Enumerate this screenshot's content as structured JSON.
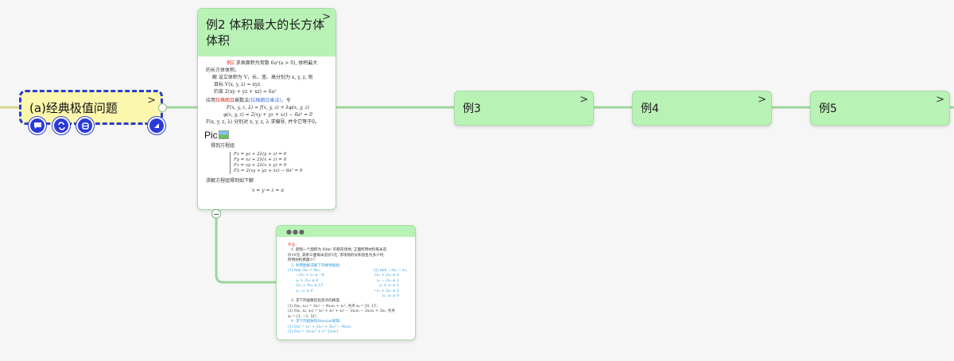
{
  "root": {
    "title": "(a)经典极值问题",
    "icons": [
      "comment-icon",
      "link-icon",
      "tag-icon"
    ]
  },
  "nodes": {
    "example2": {
      "title": "例2 体积最大的长方体体积",
      "doc": {
        "line1": "例2",
        "line1b": "求表面积为常数 6a²(a > 0), 体积最大",
        "line2": "的长方体体积。",
        "line3": "解 设立体积为 V，长、宽、高分别为 x, y, z, 则",
        "line4": "目标 V(x, y, z) = xyz",
        "line5": "约束 2(xy + yz + xz) = 6a²",
        "line6a": "应用",
        "line6b": "拉格朗日",
        "line6c": "乘数法",
        "line6d": "(拉格朗日乘法)",
        "line6e": "，令",
        "line7": "F(x, y, z, λ) = f(x, y, z) + λφ(x, y, z)",
        "line8": "φ(x, y, z) = 2(xy + yz + xz) − 6a² = 0",
        "line9": "F(x, y, z, λ) 分别对 x, y, z, λ 求偏导, 并令它等于0。",
        "pic": "Pic",
        "line10": "得到方程组",
        "sys1": "Fx = yz + 2λ(y + z) = 0",
        "sys2": "Fy = xz + 2λ(x + z) = 0",
        "sys3": "Fz = xy + 2λ(x + y) = 0",
        "sys4": "Fλ = 2(xy + yz + xz) − 6a² = 0",
        "line11": "求解方程组得到如下解",
        "line12": "x = y = z = a"
      }
    },
    "example3": {
      "title": "例3"
    },
    "example4": {
      "title": "例4"
    },
    "example5": {
      "title": "例5"
    },
    "note": {
      "dots": "●●●",
      "l1": "作业:",
      "l2": "1. 欲围一个面积为 60m² 的矩形场地, 正面所用材料每米造",
      "l3": "价10元, 其余三面每米造价5元, 求场地的长和宽各为多少时,",
      "l4": "所用材料费最少?",
      "l5": "2. 利用图解法解下列线性规划:",
      "l6a": "(1) min 3x₁ + 4x₂;",
      "l6b": "(2) min −3x₁ − x₂;",
      "l7a": "−2x₁ + x₂ ≥ −4",
      "l7b": "3x₁ + 2x₂ ≤ 6",
      "l8a": "x₁ + 2x₂ ≤ 6",
      "l8b": "x₁ − 2x₂ ≤ 1",
      "l9a": "3x₁ + 5x₂ ≤ 15",
      "l9b": "x₁ + x₂ ≥ 1",
      "l10a": "x₁, x₂ ≥ 0",
      "l10b": "−x₁ + 2x₂ ≤ 5",
      "l10c": "x₁, x₂ ≥ 0",
      "l11": "3. 求下列函数在指定点的梯度:",
      "l12": "(1) f(x₁, x₂) = 3x₁² − 4x₁x₂ + x₂², 点点 x₀ = [0, 1]ᵀ;",
      "l13": "(2) f(x₁, x₂, x₃) = x₁² + x₂² + x₃² − 2x₁x₂ − 2x₂x₃ + 3x₃, 点点",
      "l14": "x₀ = [1, −1, 3]ᵀ;",
      "l15": "4. 求下列函数的Hessian矩阵:",
      "l16": "(1) f(x) = x₁² + 2x₂² + 3x₃² − 4x₁x₂;",
      "l17": "(2) f(x) = 3x₁x₂² + e^{x₁x₂}"
    }
  },
  "colors": {
    "node_bg": "#b9f2b5",
    "root_bg": "#fbf8ad",
    "root_border": "#2b3ad6",
    "link": "#9fd59b",
    "canvas": "#f6f6f6"
  }
}
